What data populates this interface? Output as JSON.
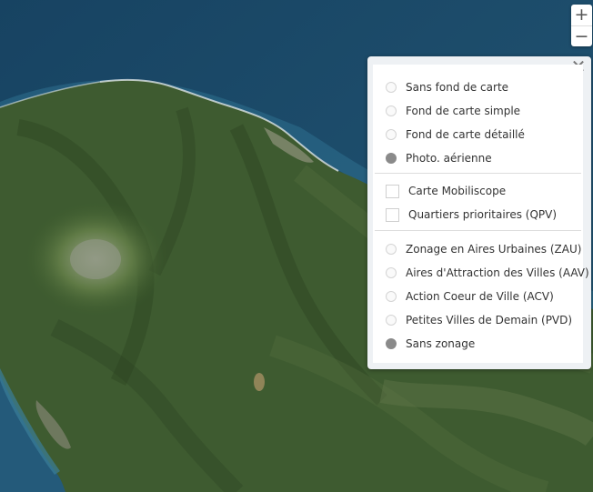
{
  "zoom": {
    "in_label": "+",
    "out_label": "−"
  },
  "panel": {
    "close_label": "✕",
    "basemaps": [
      {
        "label": "Sans fond de carte",
        "checked": false
      },
      {
        "label": "Fond de carte simple",
        "checked": false
      },
      {
        "label": "Fond de carte détaillé",
        "checked": false
      },
      {
        "label": "Photo. aérienne",
        "checked": true
      }
    ],
    "overlays": [
      {
        "label": "Carte Mobiliscope",
        "checked": false
      },
      {
        "label": "Quartiers prioritaires (QPV)",
        "checked": false
      }
    ],
    "zonings": [
      {
        "label": "Zonage en Aires Urbaines (ZAU)",
        "checked": false
      },
      {
        "label": "Aires d'Attraction des Villes (AAV)",
        "checked": false
      },
      {
        "label": "Action Coeur de Ville (ACV)",
        "checked": false
      },
      {
        "label": "Petites Villes de Demain (PVD)",
        "checked": false
      },
      {
        "label": "Sans zonage",
        "checked": true
      }
    ]
  },
  "colors": {
    "ocean_deep": "#1b4a67",
    "ocean_coast": "#2f6e8a",
    "land_dark": "#2f4a26",
    "land_mid": "#4d6a3a",
    "land_light": "#6d7f52",
    "radio_checked": "#8a8a8a"
  }
}
